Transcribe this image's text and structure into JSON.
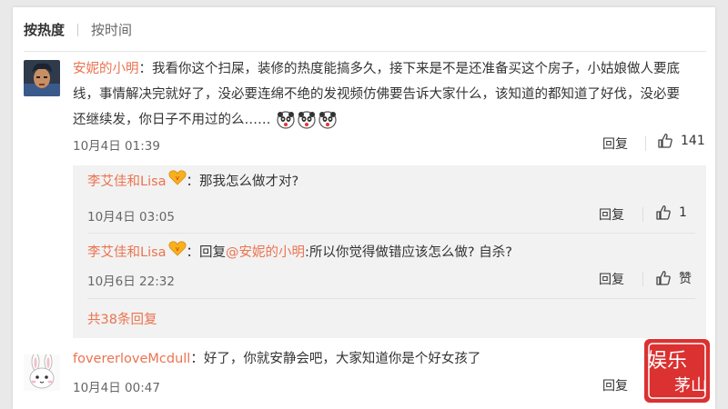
{
  "sort": {
    "hot_label": "按热度",
    "time_label": "按时间"
  },
  "comment1": {
    "username": "安妮的小明",
    "colon": "：",
    "text": "我看你这个扫屎，装修的热度能搞多久，接下来是不是还准备买这个房子，小姑娘做人要底线，事情解决完就好了，没必要连绵不绝的发视频仿佛要告诉大家什么，该知道的都知道了好伐，没必要还继续发，你日子不用过的么……",
    "date": "10月4日 01:39",
    "reply_label": "回复",
    "like_count": "141"
  },
  "replies": [
    {
      "username": "李艾佳和Lisa",
      "colon": "：",
      "text": "那我怎么做才对?",
      "date": "10月4日 03:05",
      "reply_label": "回复",
      "like_count": "1"
    },
    {
      "username": "李艾佳和Lisa",
      "colon": "：",
      "prefix": "回复",
      "mention": "@安妮的小明",
      "text": ":所以你觉得做错应该怎么做? 自杀?",
      "date": "10月6日 22:32",
      "reply_label": "回复",
      "like_label": "赞"
    }
  ],
  "more_replies": "共38条回复",
  "comment2": {
    "username": "fovererloveMcdull",
    "colon": "：",
    "text": "好了，你就安静会吧，大家知道你是个好女孩了",
    "date": "10月4日 00:47",
    "reply_label": "回复"
  },
  "watermark": {
    "text": "娱乐",
    "text2": "茅山"
  },
  "colors": {
    "accent": "#eb7350",
    "reply_bg": "#f2f2f2",
    "watermark_red": "#d8201f"
  }
}
